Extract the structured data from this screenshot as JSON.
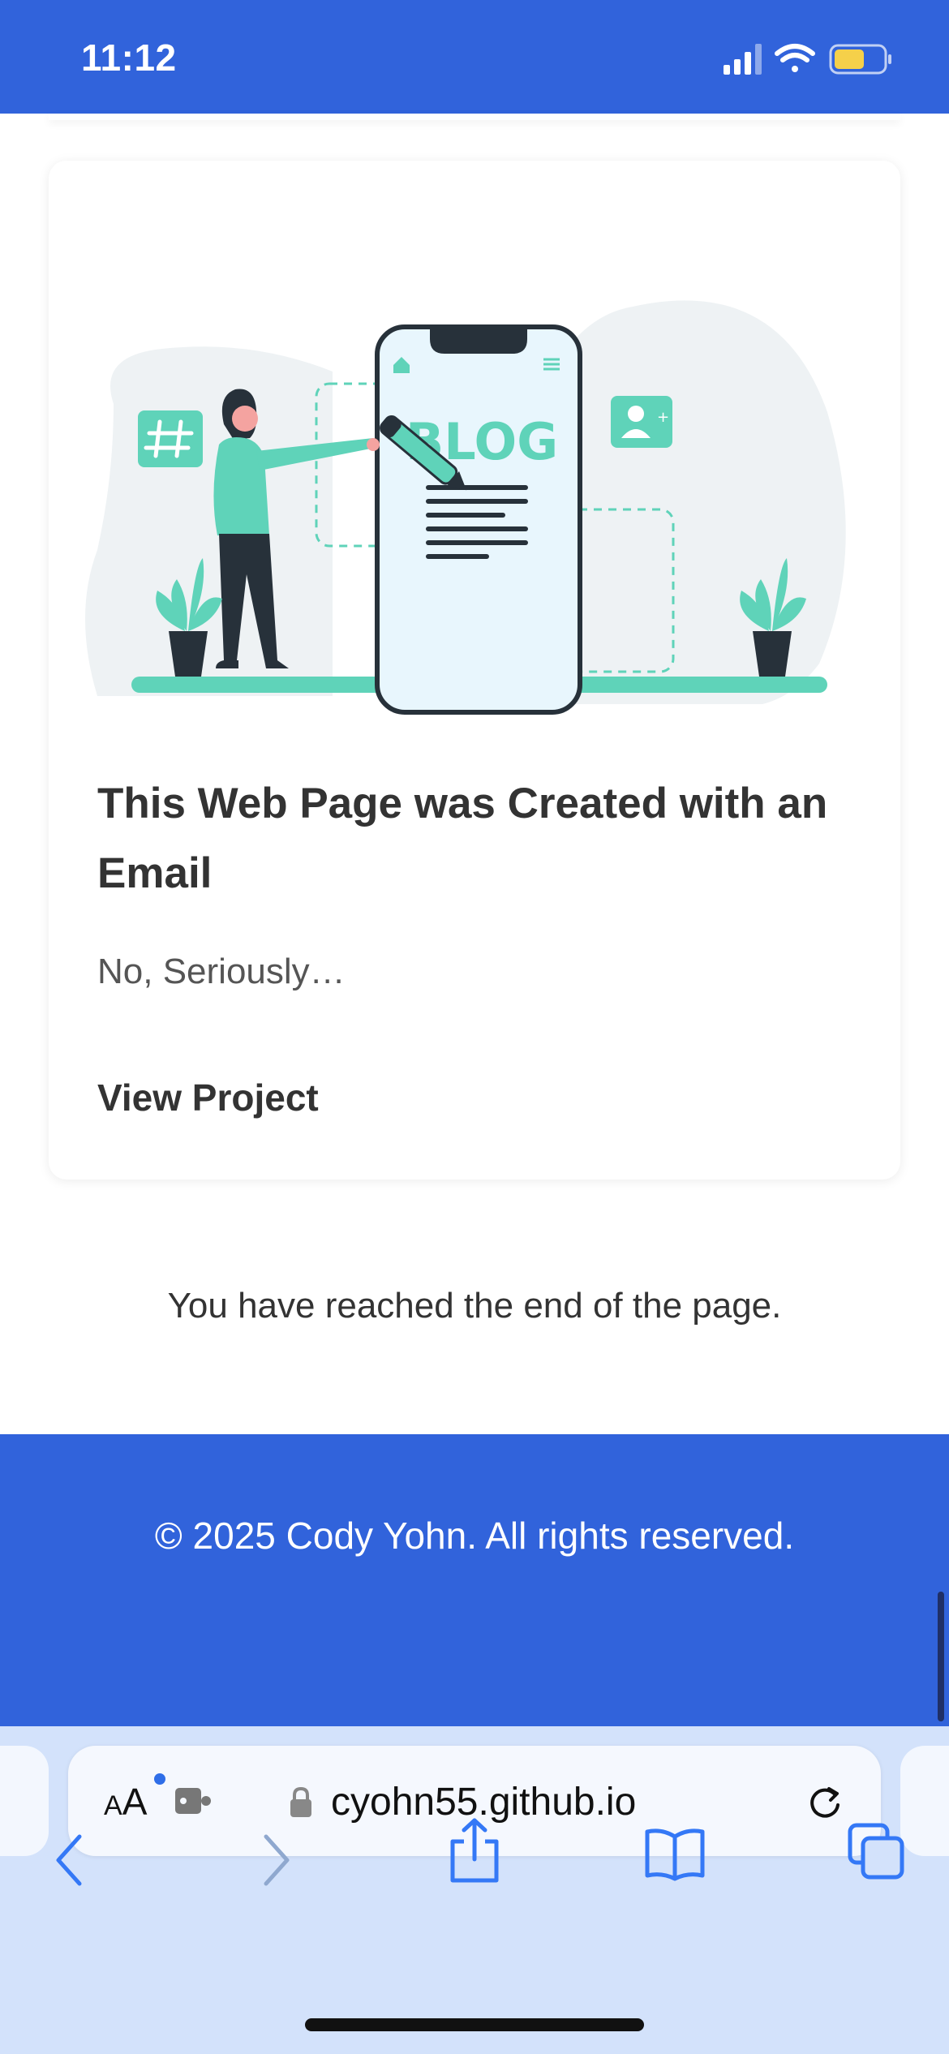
{
  "status_bar": {
    "time": "11:12",
    "background": "#3163db",
    "icons": [
      "cellular-signal-icon",
      "wifi-icon",
      "battery-icon"
    ],
    "battery_color": "#f5d04a"
  },
  "card": {
    "illustration_text": "BLOG",
    "title": "This Web Page was Created with an Email",
    "subtitle": "No, Seriously…",
    "link_label": "View Project",
    "accent_color": "#5fd3b9"
  },
  "page": {
    "end_message": "You have reached the end of the page."
  },
  "footer": {
    "text": "© 2025 Cody Yohn. All rights reserved.",
    "background": "#3163db"
  },
  "browser": {
    "text_size_label_small": "A",
    "text_size_label_large": "A",
    "url": "cyohn55.github.io",
    "toolbar_icons": [
      "back-icon",
      "forward-icon",
      "share-icon",
      "bookmarks-icon",
      "tabs-icon"
    ],
    "background": "#d3e2fb"
  }
}
